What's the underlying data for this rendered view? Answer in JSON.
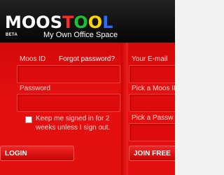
{
  "brand": {
    "logo_letters": [
      {
        "char": "M",
        "color": "#ffffff"
      },
      {
        "char": "O",
        "color": "#ffffff"
      },
      {
        "char": "O",
        "color": "#ffffff"
      },
      {
        "char": "S",
        "color": "#ffffff"
      },
      {
        "char": "T",
        "color": "#ff2a2a"
      },
      {
        "char": "O",
        "color": "#19c232"
      },
      {
        "char": "O",
        "color": "#ffd400"
      },
      {
        "char": "L",
        "color": "#2a6cff"
      }
    ],
    "beta": "BETA",
    "tagline": "My Own Office Space"
  },
  "login": {
    "moos_id_label": "Moos ID",
    "forgot_link": "Forgot password?",
    "password_label": "Password",
    "moos_id_value": "",
    "password_value": "",
    "keep_signed_in": "Keep me signed in for 2 weeks unless I sign out.",
    "keep_signed_in_checked": false,
    "login_button": "LOGIN"
  },
  "signup": {
    "email_label": "Your E-mail",
    "moos_id_label": "Pick a Moos ID",
    "password_label": "Pick a Passw",
    "join_button": "JOIN FREE"
  },
  "colors": {
    "header_bg": "#0a0a0a",
    "panel_bg": "#e20d0d"
  }
}
